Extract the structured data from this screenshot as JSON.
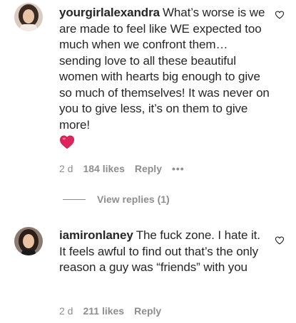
{
  "comments": [
    {
      "username": "yourgirlalexandra",
      "text": "What’s worse is we are made to feel like WE expected too much when we confront them…sending love to all these beautiful women with hearts big enough to give so much of themselves! It was never on you to give less, it’s on them to give more!",
      "emoji": "red-heart",
      "time": "2 d",
      "likes": "184 likes",
      "reply_label": "Reply",
      "more_label": "•••",
      "view_replies": "View replies (1)"
    },
    {
      "username": "iamironlaney",
      "text": "The fuck zone. I hate it. It feels awful to find out that’s the only reason a guy was “friends” with you",
      "time": "2 d",
      "likes": "211 likes",
      "reply_label": "Reply"
    }
  ],
  "icons": {
    "like": "heart-outline-icon",
    "emoji": "red-heart-icon"
  },
  "colors": {
    "text": "#262626",
    "secondary": "#8e8e8e",
    "heart": "#e0245e"
  }
}
